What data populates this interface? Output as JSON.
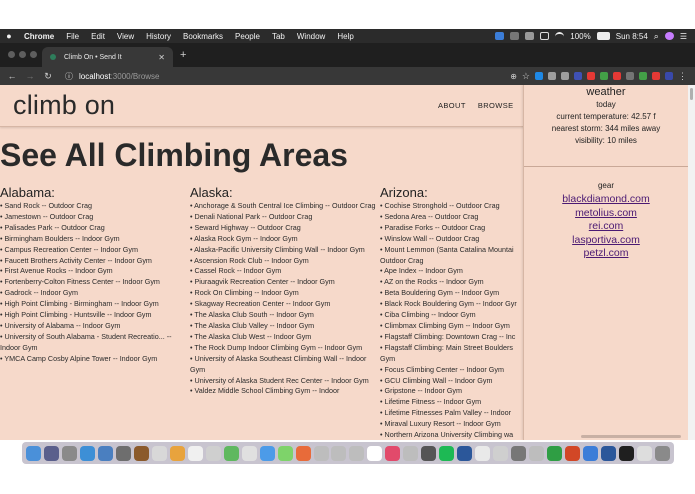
{
  "menubar": {
    "app_name": "Chrome",
    "items": [
      "File",
      "Edit",
      "View",
      "History",
      "Bookmarks",
      "People",
      "Tab",
      "Window",
      "Help"
    ],
    "battery": "100%",
    "clock": "Sun 8:54",
    "icons": [
      "drive-icon",
      "mic-icon",
      "download-icon",
      "airplay-icon",
      "wifi-icon",
      "battery-icon",
      "search-icon",
      "user-icon",
      "list-icon"
    ]
  },
  "browser": {
    "tab_title": "Climb On • Send It",
    "new_tab_symbol": "+",
    "close_symbol": "✕",
    "url_host": "localhost",
    "url_path": ":3000/Browse",
    "extension_colors": [
      "#1e88e5",
      "#9e9e9e",
      "#9e9e9e",
      "#3f51b5",
      "#e53935",
      "#43a047",
      "#e53935",
      "#757575",
      "#43a047",
      "#e53935",
      "#3949ab"
    ]
  },
  "site": {
    "logo": "climb on",
    "nav": [
      "ABOUT",
      "BROWSE"
    ],
    "page_title": "See All Climbing Areas"
  },
  "states": [
    {
      "name": "Alabama:",
      "areas": [
        "• Sand Rock -- Outdoor Crag",
        "• Jamestown -- Outdoor Crag",
        "• Palisades Park -- Outdoor Crag",
        "• Birmingham Boulders -- Indoor Gym",
        "• Campus Recreation Center -- Indoor Gym",
        "• Faucett Brothers Activity Center -- Indoor Gym",
        "• First Avenue Rocks -- Indoor Gym",
        "• Fortenberry-Colton Fitness Center -- Indoor Gym",
        "• Gadrock -- Indoor Gym",
        "• High Point Climbing - Birmingham -- Indoor Gym",
        "• High Point Climbing - Huntsville -- Indoor Gym",
        "• University of Alabama -- Indoor Gym",
        "• University of South Alabama - Student Recreatio... -- Indoor Gym",
        "• YMCA Camp Cosby Alpine Tower -- Indoor Gym"
      ]
    },
    {
      "name": "Alaska:",
      "areas": [
        "• Anchorage & South Central Ice Climbing -- Outdoor Crag",
        "• Denali National Park -- Outdoor Crag",
        "• Seward Highway -- Outdoor Crag",
        "• Alaska Rock Gym -- Indoor Gym",
        "• Alaska-Pacific University Climbing Wall -- Indoor Gym",
        "• Ascension Rock Club -- Indoor Gym",
        "• Cassel Rock -- Indoor Gym",
        "• Piuraagvik Recreation Center -- Indoor Gym",
        "• Rock On Climbing -- Indoor Gym",
        "• Skagway Recreation Center -- Indoor Gym",
        "• The Alaska Club South -- Indoor Gym",
        "• The Alaska Club Valley -- Indoor Gym",
        "• The Alaska Club West -- Indoor Gym",
        "• The Rock Dump Indoor Climbing Gym -- Indoor Gym",
        "• University of Alaska Southeast Climbing Wall -- Indoor Gym",
        "• University of Alaska Student Rec Center -- Indoor Gym",
        "• Valdez Middle School Climbing Gym -- Indoor"
      ]
    },
    {
      "name": "Arizona:",
      "areas": [
        "• Cochise Stronghold -- Outdoor Crag",
        "• Sedona Area -- Outdoor Crag",
        "• Paradise Forks -- Outdoor Crag",
        "• Winslow Wall -- Outdoor Crag",
        "• Mount Lemmon (Santa Catalina Mountai",
        "Outdoor Crag",
        "• Ape Index -- Indoor Gym",
        "• AZ on the Rocks -- Indoor Gym",
        "• Beta Bouldering Gym -- Indoor Gym",
        "• Black Rock Bouldering Gym -- Indoor Gyr",
        "• Ciba Climbing -- Indoor Gym",
        "• Climbmax Climbing Gym -- Indoor Gym",
        "• Flagstaff Climbing: Downtown Crag -- Inc",
        "• Flagstaff Climbing: Main Street Boulders",
        "Gym",
        "• Focus Climbing Center -- Indoor Gym",
        "• GCU Climbing Wall -- Indoor Gym",
        "• Gripstone -- Indoor Gym",
        "• Lifetime Fitness -- Indoor Gym",
        "• Lifetime Fitnesses Palm Valley -- Indoor",
        "• Miraval Luxury Resort -- Indoor Gym",
        "• Northern Arizona University Climbing wa"
      ]
    }
  ],
  "weather": {
    "title": "weather",
    "day": "today",
    "current": "current temperature: 42.57 f",
    "storm": "nearest storm: 344 miles away",
    "visibility": "visibility: 10 miles"
  },
  "gear": {
    "title": "gear",
    "links": [
      "blackdiamond.com",
      "metolius.com",
      "rei.com",
      "lasportiva.com",
      "petzl.com"
    ]
  },
  "dock": {
    "icon_colors": [
      "#4a90d9",
      "#5a5f8c",
      "#8a8a8a",
      "#3d8fd6",
      "#4a7fc0",
      "#6e6e6e",
      "#8b5a2b",
      "#d8d8d8",
      "#e8a33d",
      "#f0f0f0",
      "#cfcfcf",
      "#5fb85f",
      "#e0e0e0",
      "#4c9be8",
      "#7ed36a",
      "#e86b3a",
      "#bdbdbd",
      "#bdbdbd",
      "#bdbdbd",
      "#ffffff",
      "#e24a6b",
      "#bdbdbd",
      "#555555",
      "#1db954",
      "#2b579a",
      "#e9e9e9",
      "#cfcfcf",
      "#777777",
      "#bdbdbd",
      "#2f9e44",
      "#d24726",
      "#3b7dd8",
      "#2b579a",
      "#1f1f1f",
      "#dddddd",
      "#8a8a8a"
    ]
  }
}
